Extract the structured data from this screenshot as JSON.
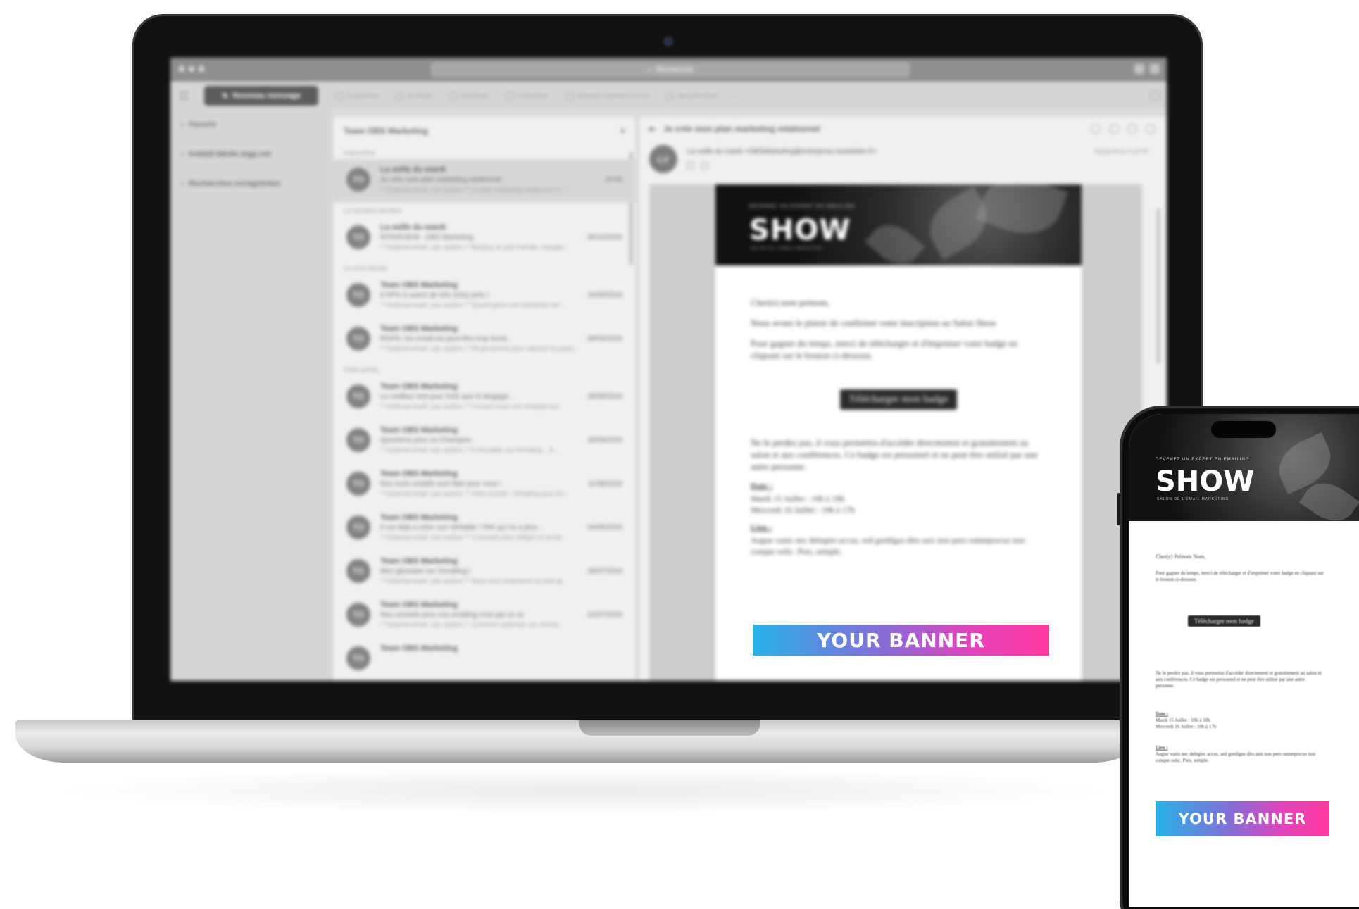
{
  "window": {
    "search_placeholder": "Recherche"
  },
  "toolbar": {
    "new_message": "Nouveau message",
    "items": [
      "Supprimer",
      "Archiver",
      "Déplacer",
      "Indicateur",
      "Marquer comme non lu",
      "Synchroniser"
    ],
    "more": "···"
  },
  "folders": [
    {
      "label": "Favoris"
    },
    {
      "label": "holdall-b8n9x.mgp.net"
    },
    {
      "label": "Recherches enregistrées"
    }
  ],
  "message_list": {
    "title": "Team OBS Marketing",
    "groups": [
      {
        "label": "Aujourd'hui",
        "messages": [
          {
            "avatar": "TO",
            "from": "La veille du mardi",
            "subject": "Je crée mon plan marketing relationnel",
            "date": "10:00",
            "preview": "** External email: use caution ** Le plan marketing relationnel vo..."
          }
        ]
      },
      {
        "label": "La semaine dernière",
        "messages": [
          {
            "avatar": "TO",
            "from": "La veille du mardi",
            "subject": "INTERVIEW - OBS Marketing",
            "date": "06/10/2020",
            "preview": "** External email: use caution ** Bonjour, je suis Camille, chargée..."
          }
        ]
      },
      {
        "label": "Le mois dernier",
        "messages": [
          {
            "avatar": "TO",
            "from": "Team OBS Marketing",
            "subject": "6 KPIs à suivre de très (très) près !",
            "date": "15/09/2020",
            "preview": "** External email: use caution ** Quand gérer une entreprise ser..."
          },
          {
            "avatar": "TO",
            "from": "Team OBS Marketing",
            "subject": "RGPD, ton email est peut-être trop lourd...",
            "date": "08/09/2020",
            "preview": "** External email: use caution ** 99 personnes pour relancer le poste..."
          }
        ]
      },
      {
        "label": "Cette année",
        "messages": [
          {
            "avatar": "TO",
            "from": "Team OBS Marketing",
            "subject": "Le meilleur test pour forte que le langage...",
            "date": "28/08/2020",
            "preview": "** External email: use caution ** Trouvez-vous une stratégie qui..."
          },
          {
            "avatar": "TO",
            "from": "Team OBS Marketing",
            "subject": "Questions pour un Champion",
            "date": "18/08/2020",
            "preview": "** External email: use caution ** 5 nouvelles sur l'emailing... À..."
          },
          {
            "avatar": "TO",
            "from": "Team OBS Marketing",
            "subject": "Des mots créatifs sont faits pour vous !",
            "date": "11/08/2020",
            "preview": "** External email: use caution ** Votre conseil : l'emailing pour ton..."
          },
          {
            "avatar": "TO",
            "from": "Team OBS Marketing",
            "subject": "Il est déjà à créer une véritable / l'été qui ne a plus...",
            "date": "04/08/2020",
            "preview": "** External email: use caution ** 3 conseils pour rédiger un email..."
          },
          {
            "avatar": "TO",
            "from": "Team OBS Marketing",
            "subject": "Mon glossaire sur l'emailing !",
            "date": "28/07/2020",
            "preview": "** External email: use caution ** Nous vous proposons ce petit gl..."
          },
          {
            "avatar": "TO",
            "from": "Team OBS Marketing",
            "subject": "Nos conseils pour vos emailing c'est par ici ce",
            "date": "21/07/2020",
            "preview": "** External email: use caution ** Comment optimiser vos envois..."
          },
          {
            "avatar": "TO",
            "from": "Team OBS Marketing",
            "subject": "",
            "date": "",
            "preview": ""
          }
        ]
      }
    ]
  },
  "reading_pane": {
    "subject": "Je crée mon plan marketing relationnel",
    "sender_avatar": "LV",
    "sender_line": "La veille du mardi <OBSMarketing@entreprise.newsletter.fr>",
    "time": "Aujourd'hui à 10:00"
  },
  "email": {
    "hero_top": "DEVENEZ UN EXPERT EN EMAILING",
    "hero_title": "SHOW",
    "hero_sub": "SALON DE L'EMAIL MARKETING",
    "greeting": "Cher(e) nom prénom,",
    "p1": "Nous avons le plaisir de confirmer votre inscription au Salon Show",
    "p2": "Pour gagner du temps, merci de télécharger et d'imprimer votre badge en cliquant sur le bouton ci-dessous.",
    "cta": "Télécharger mon badge",
    "p3": "Ne le perdez pas, il vous permettra d'accéder directement et gratuitement au salon et aux conférences. Ce badge est personnel et ne peut être utilisé par une autre personne.",
    "date_label": "Date :",
    "date_line1": "Mardi 15 Juillet : 10h à 18h",
    "date_line2": "Mercredi 16 Juillet : 10h à 17h",
    "place_label": "Lieu :",
    "place_text": "Augue vanis nec delegies accus, sed gordigus dito asis non pero onmeprocus non conque solic. Puis, semple.",
    "banner": "YOUR BANNER"
  },
  "phone": {
    "greeting": "Cher(e) Prénom Nom,",
    "cta": "Télécharger mon badge",
    "banner": "YOUR BANNER"
  }
}
